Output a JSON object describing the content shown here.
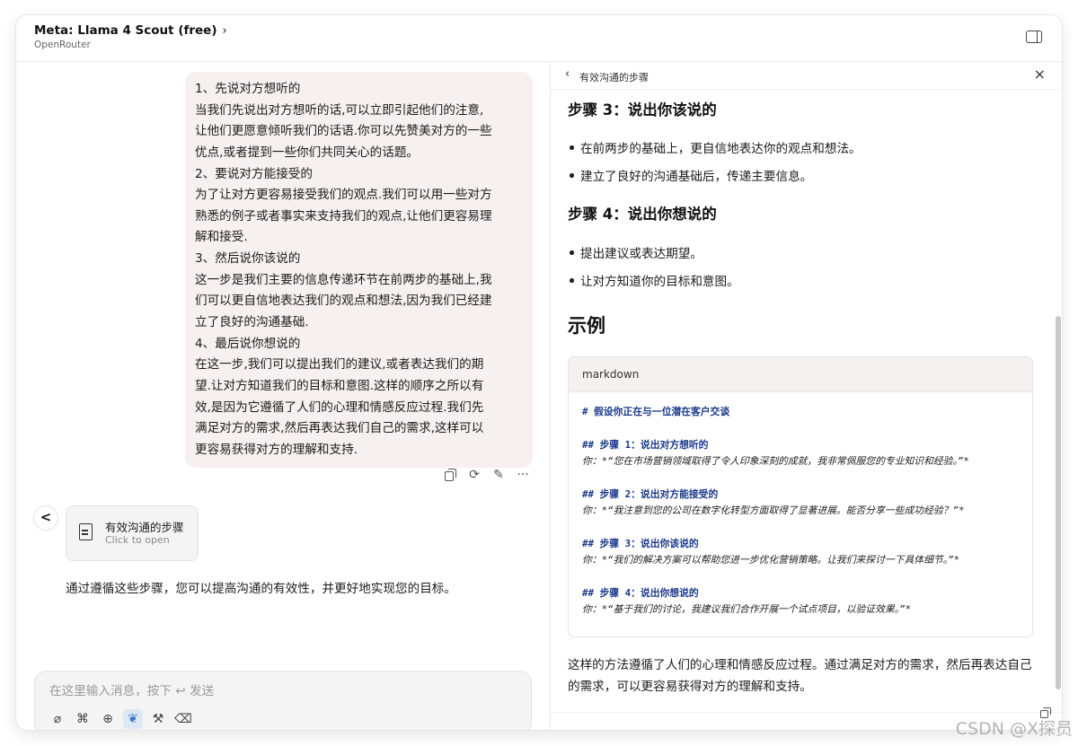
{
  "header": {
    "model_title": "Meta: Llama 4 Scout (free)",
    "chevron": "›",
    "provider": "OpenRouter"
  },
  "chat": {
    "user_message_lines": [
      "1、先说对方想听的",
      "当我们先说出对方想听的话,可以立即引起他们的注意,",
      "让他们更愿意倾听我们的话语.你可以先赞美对方的一些",
      "优点,或者提到一些你们共同关心的话题。",
      "2、要说对方能接受的",
      "为了让对方更容易接受我们的观点.我们可以用一些对方",
      "熟悉的例子或者事实来支持我们的观点,让他们更容易理",
      "解和接受.",
      "3、然后说你该说的",
      "这一步是我们主要的信息传递环节在前两步的基础上,我",
      "们可以更自信地表达我们的观点和想法,因为我们已经建",
      "立了良好的沟通基础.",
      "4、最后说你想说的",
      "在这一步,我们可以提出我们的建议,或者表达我们的期",
      "望.让对方知道我们的目标和意图.这样的顺序之所以有",
      "效,是因为它遵循了人们的心理和情感反应过程.我们先",
      "满足对方的需求,然后再表达我们自己的需求,这样可以",
      "更容易获得对方的理解和支持."
    ],
    "actions": {
      "copy_icon": "copy-icon",
      "regenerate_glyph": "⟳",
      "edit_glyph": "✎",
      "more_glyph": "···"
    },
    "assistant_avatar": "<",
    "artifact_card": {
      "title": "有效沟通的步骤",
      "subtitle": "Click to open"
    },
    "summary": "通过遵循这些步骤，您可以提高沟通的有效性，并更好地实现您的目标。",
    "input": {
      "placeholder": "在这里输入消息，按下 ↩ 发送",
      "value": ""
    },
    "tools": [
      {
        "name": "attachment-icon",
        "glyph": "⌀"
      },
      {
        "name": "command-icon",
        "glyph": "⌘"
      },
      {
        "name": "globe-icon",
        "glyph": "⊕"
      },
      {
        "name": "leaf-icon",
        "glyph": "❦"
      },
      {
        "name": "hammer-icon",
        "glyph": "⚒"
      },
      {
        "name": "eraser-icon",
        "glyph": "⌫"
      }
    ]
  },
  "artifact": {
    "title": "有效沟通的步骤",
    "back_glyph": "‹",
    "close_glyph": "×",
    "step3_heading": "步骤 3：说出你该说的",
    "step3_items": [
      "在前两步的基础上，更自信地表达你的观点和想法。",
      "建立了良好的沟通基础后，传递主要信息。"
    ],
    "step4_heading": "步骤 4：说出你想说的",
    "step4_items": [
      "提出建议或表达期望。",
      "让对方知道你的目标和意图。"
    ],
    "example_heading": "示例",
    "code_lang": "markdown",
    "code_lines": [
      {
        "kind": "h",
        "text": "#  假设你正在与一位潜在客户交谈"
      },
      {
        "kind": "h",
        "text": "##  步骤 1：说出对方想听的"
      },
      {
        "kind": "t",
        "text": "你：*“您在市场营销领域取得了令人印象深刻的成就，我非常佩服您的专业知识和经验。”*"
      },
      {
        "kind": "h",
        "text": "##  步骤 2：说出对方能接受的"
      },
      {
        "kind": "t",
        "text": "你：*“我注意到您的公司在数字化转型方面取得了显著进展。能否分享一些成功经验？”*"
      },
      {
        "kind": "h",
        "text": "##  步骤 3：说出你该说的"
      },
      {
        "kind": "t",
        "text": "你：*“我们的解决方案可以帮助您进一步优化营销策略。让我们来探讨一下具体细节。”*"
      },
      {
        "kind": "h",
        "text": "##  步骤 4：说出你想说的"
      },
      {
        "kind": "t",
        "text": "你：*“基于我们的讨论，我建议我们合作开展一个试点项目，以验证效果。”*"
      }
    ],
    "conclusion": "这样的方法遵循了人们的心理和情感反应过程。通过满足对方的需求，然后再表达自己的需求，可以更容易获得对方的理解和支持。"
  },
  "watermark": "CSDN @X探员",
  "colors": {
    "bubble_bg": "#f6f0f0",
    "tool_active_bg": "#dce8f6",
    "code_heading": "#1b3a8a"
  }
}
